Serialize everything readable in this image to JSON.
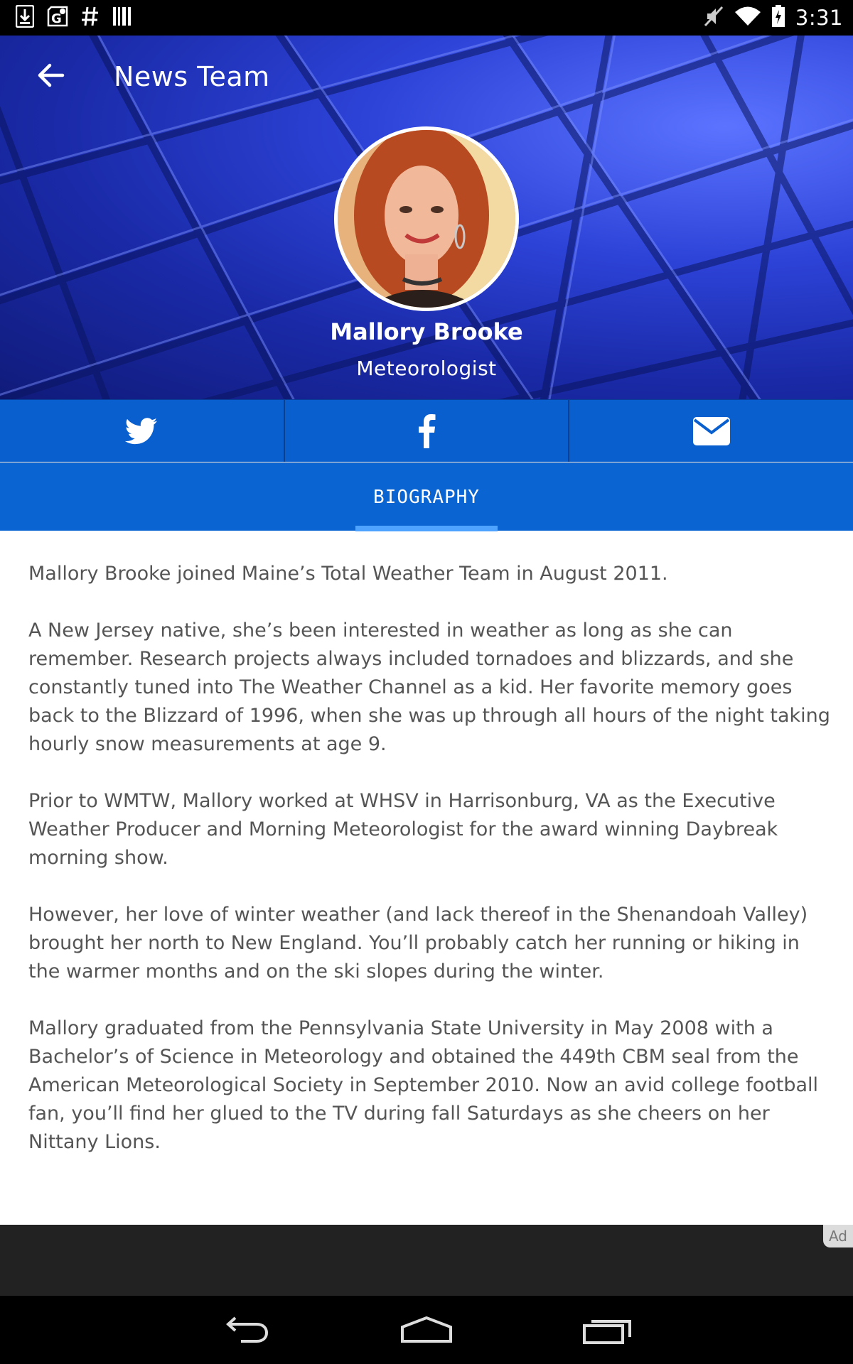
{
  "status_bar": {
    "time": "3:31"
  },
  "header": {
    "title": "News Team"
  },
  "profile": {
    "name": "Mallory Brooke",
    "role": "Meteorologist"
  },
  "social": {
    "items": [
      "twitter-icon",
      "facebook-icon",
      "email-icon"
    ]
  },
  "tabs": [
    {
      "label": "BIOGRAPHY",
      "selected": true
    }
  ],
  "biography": {
    "paragraphs": [
      "Mallory Brooke joined Maine’s Total Weather Team in August 2011.",
      "A New Jersey native, she’s been interested in weather as long as she can remember. Research projects always included tornadoes and blizzards, and she constantly tuned into The Weather Channel as a kid. Her favorite memory goes back to the Blizzard of 1996, when she was up through all hours of the night taking hourly snow measurements at age 9.",
      "Prior to WMTW, Mallory worked at WHSV in Harrisonburg, VA as the Executive Weather Producer and Morning Meteorologist for the award winning Daybreak morning show.",
      "However, her love of winter weather (and lack thereof in the Shenandoah Valley) brought her north to New England. You’ll probably catch her running or hiking in the warmer months and on the ski slopes during the winter.",
      "Mallory graduated from the Pennsylvania State University in May 2008 with a Bachelor’s of Science in Meteorology and obtained the 449th CBM seal from the American Meteorological Society in September 2010. Now an avid college football fan, you’ll find her glued to the TV during fall Saturdays as she cheers on her Nittany Lions."
    ]
  },
  "ad": {
    "badge": "Ad"
  },
  "colors": {
    "primary": "#0a64d2",
    "social_bar": "#0a5fcf",
    "tab_indicator": "#4da3ff",
    "body_text": "#555555"
  }
}
